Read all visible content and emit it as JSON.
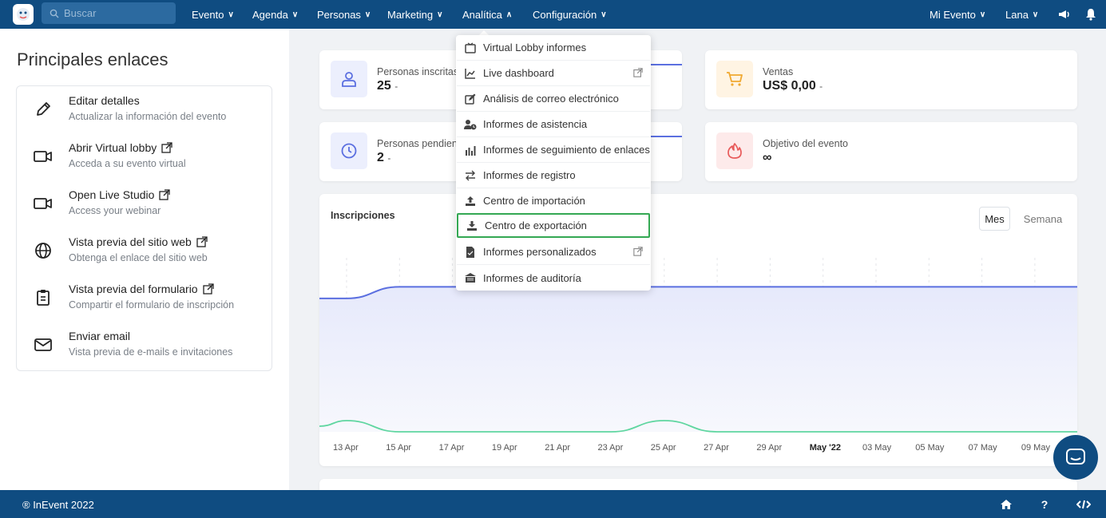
{
  "nav": {
    "search_placeholder": "Buscar",
    "items": [
      {
        "label": "Evento"
      },
      {
        "label": "Agenda"
      },
      {
        "label": "Personas"
      },
      {
        "label": "Marketing"
      },
      {
        "label": "Analítica"
      },
      {
        "label": "Configuración"
      }
    ],
    "right": [
      {
        "label": "Mi Evento"
      },
      {
        "label": "Lana"
      }
    ],
    "icons": [
      "megaphone-icon",
      "bell-icon"
    ]
  },
  "left": {
    "title": "Principales enlaces",
    "links": [
      {
        "title": "Editar detalles",
        "subtitle": "Actualizar la información del evento",
        "icon": "pencil-icon",
        "external": false
      },
      {
        "title": "Abrir Virtual lobby",
        "subtitle": "Acceda a su evento virtual",
        "icon": "video-camera-icon",
        "external": true
      },
      {
        "title": "Open Live Studio",
        "subtitle": "Access your webinar",
        "icon": "video-camera-icon",
        "external": true
      },
      {
        "title": "Vista previa del sitio web",
        "subtitle": "Obtenga el enlace del sitio web",
        "icon": "globe-icon",
        "external": true
      },
      {
        "title": "Vista previa del formulario",
        "subtitle": "Compartir el formulario de inscripción",
        "icon": "clipboard-icon",
        "external": true
      },
      {
        "title": "Enviar email",
        "subtitle": "Vista previa de e-mails e invitaciones",
        "icon": "envelope-icon",
        "external": false
      }
    ]
  },
  "stats": [
    {
      "label": "Personas inscritas",
      "value": "25",
      "suffix": "-",
      "icon": "user-icon",
      "color": "#5b6fe0"
    },
    {
      "label": "Personas pendien",
      "value": "2",
      "suffix": "-",
      "icon": "clock-icon",
      "color": "#5b6fe0"
    },
    {
      "label": "Ventas",
      "value": "US$ 0,00",
      "suffix": "-",
      "icon": "cart-icon",
      "color": "#f0a830"
    },
    {
      "label": "Objetivo del evento",
      "value": "∞",
      "suffix": "",
      "icon": "fire-icon",
      "color": "#e85a5a"
    }
  ],
  "chart": {
    "title": "Inscripciones",
    "periods": [
      "Mes",
      "Semana"
    ],
    "selected_period": "Mes",
    "colors": {
      "line": "#5b6fe0",
      "area": "#e6e9fb",
      "secondary": "#5fd6a0"
    }
  },
  "chart_data": {
    "type": "area",
    "title": "Inscripciones",
    "x_ticks": [
      "13 Apr",
      "15 Apr",
      "17 Apr",
      "19 Apr",
      "21 Apr",
      "23 Apr",
      "25 Apr",
      "27 Apr",
      "29 Apr",
      "May '22",
      "03 May",
      "05 May",
      "07 May",
      "09 May"
    ],
    "series": [
      {
        "values": [
          23,
          25,
          25,
          25,
          25,
          25,
          25,
          25,
          25,
          25,
          25,
          25,
          25,
          25
        ]
      },
      {
        "values": [
          1,
          0,
          0,
          0,
          0,
          0,
          1,
          0,
          0,
          0,
          0,
          0,
          0,
          0
        ]
      }
    ],
    "grid": true,
    "legend": "none"
  },
  "dropdown": {
    "items": [
      {
        "label": "Virtual Lobby informes",
        "icon": "tv-icon",
        "external": false
      },
      {
        "label": "Live dashboard",
        "icon": "line-chart-icon",
        "external": true
      },
      {
        "label": "Análisis de correo electrónico",
        "icon": "edit-icon",
        "external": false
      },
      {
        "label": "Informes de asistencia",
        "icon": "user-clock-icon",
        "external": false
      },
      {
        "label": "Informes de seguimiento de enlaces",
        "icon": "bar-chart-icon",
        "external": false
      },
      {
        "label": "Informes de registro",
        "icon": "exchange-icon",
        "external": false
      },
      {
        "label": "Centro de importación",
        "icon": "upload-icon",
        "external": false
      },
      {
        "label": "Centro de exportación",
        "icon": "download-icon",
        "external": false,
        "highlighted": true
      },
      {
        "label": "Informes personalizados",
        "icon": "file-icon",
        "external": true
      },
      {
        "label": "Informes de auditoría",
        "icon": "archive-icon",
        "external": false
      }
    ]
  },
  "footer": {
    "copyright": "® InEvent 2022",
    "icons": [
      "home-icon",
      "help-icon",
      "code-icon"
    ],
    "help_glyph": "?"
  }
}
